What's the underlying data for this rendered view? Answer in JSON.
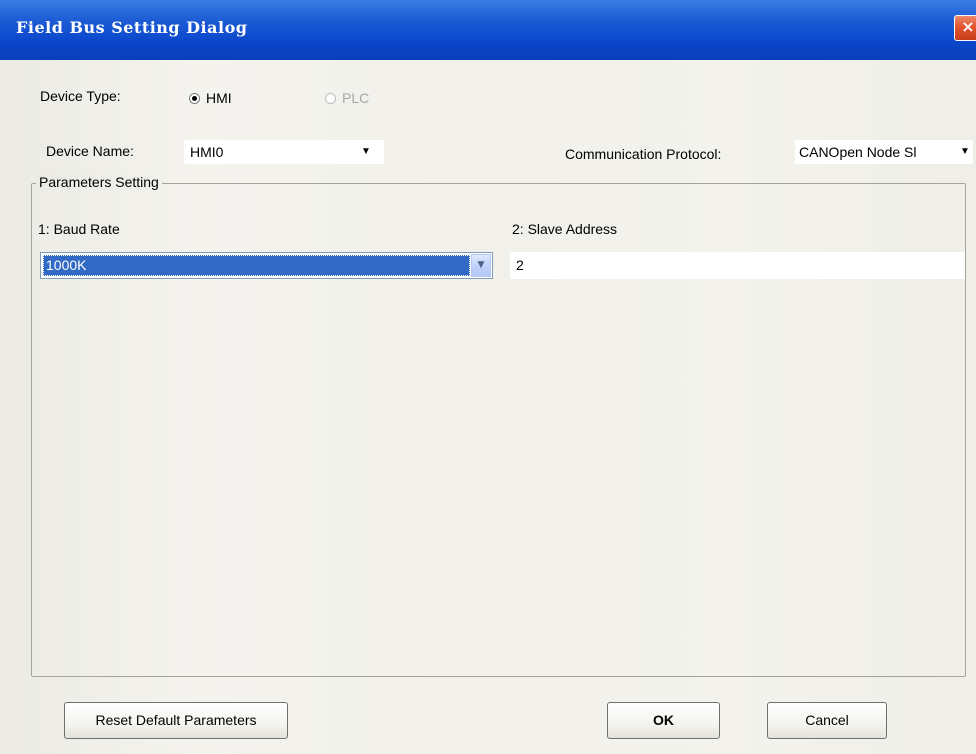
{
  "window": {
    "title": "Field Bus Setting Dialog",
    "close_glyph": "×"
  },
  "device_type": {
    "label": "Device Type:",
    "options": [
      {
        "label": "HMI",
        "selected": true,
        "enabled": true
      },
      {
        "label": "PLC",
        "selected": false,
        "enabled": false
      }
    ]
  },
  "device_name": {
    "label": "Device Name:",
    "value": "HMI0"
  },
  "communication_protocol": {
    "label": "Communication Protocol:",
    "value": "CANOpen Node Sl"
  },
  "parameters": {
    "group_label": "Parameters Setting",
    "baud_rate": {
      "label": "1: Baud Rate",
      "value": "1000K"
    },
    "slave_address": {
      "label": "2: Slave Address",
      "value": "2"
    }
  },
  "buttons": {
    "reset": "Reset Default Parameters",
    "ok": "OK",
    "cancel": "Cancel"
  },
  "icons": {
    "dropdown_arrow": "chevron-down-icon",
    "close": "close-icon"
  },
  "colors": {
    "titlebar": "#0a46cc",
    "selection": "#316ac5",
    "close_button": "#e2552f"
  }
}
